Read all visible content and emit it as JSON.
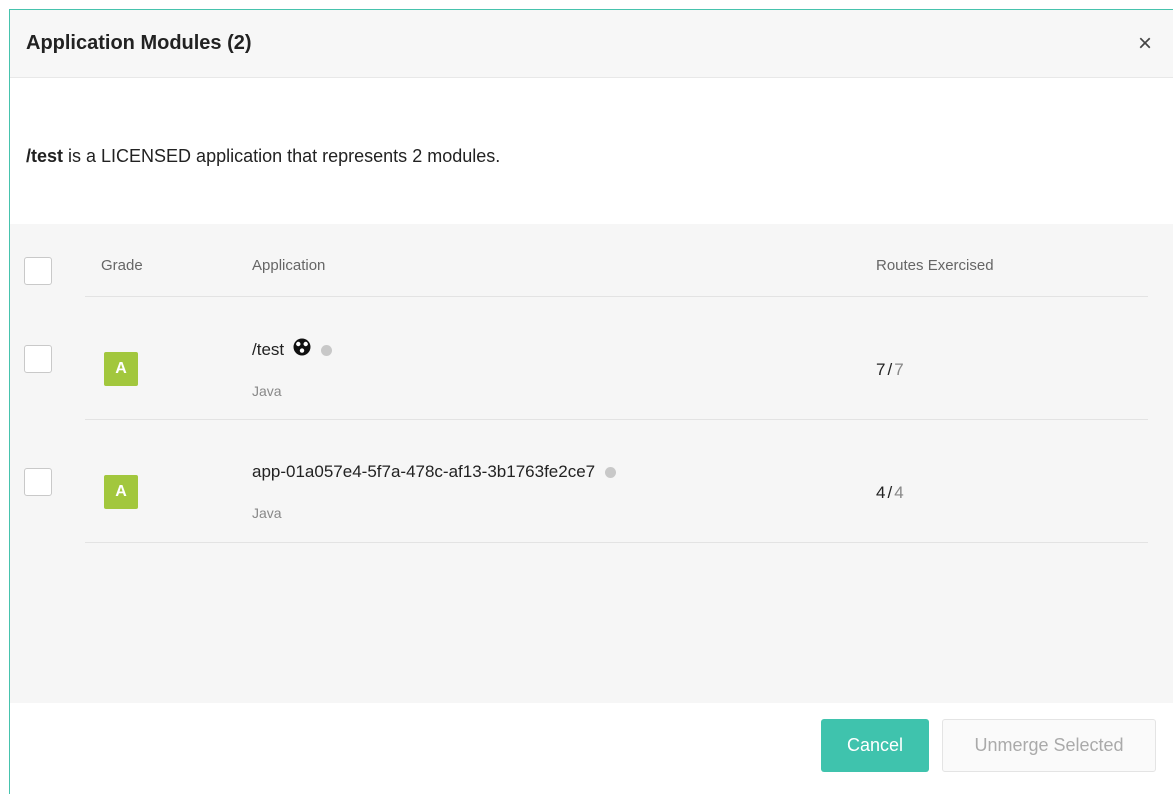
{
  "modal": {
    "title": "Application Modules (2)",
    "close_icon": "×"
  },
  "intro": {
    "app_name": "/test",
    "text": " is a LICENSED application that represents 2 modules."
  },
  "table": {
    "columns": {
      "grade": "Grade",
      "application": "Application",
      "routes": "Routes Exercised"
    },
    "rows": [
      {
        "grade": "A",
        "name": "/test",
        "has_library_icon": true,
        "language": "Java",
        "routes_exercised": "7",
        "routes_total": "7"
      },
      {
        "grade": "A",
        "name": "app-01a057e4-5f7a-478c-af13-3b1763fe2ce7",
        "has_library_icon": false,
        "language": "Java",
        "routes_exercised": "4",
        "routes_total": "4"
      }
    ]
  },
  "footer": {
    "cancel_label": "Cancel",
    "unmerge_label": "Unmerge Selected"
  },
  "colors": {
    "accent": "#3fc3ad",
    "grade_a": "#a2c73d"
  }
}
